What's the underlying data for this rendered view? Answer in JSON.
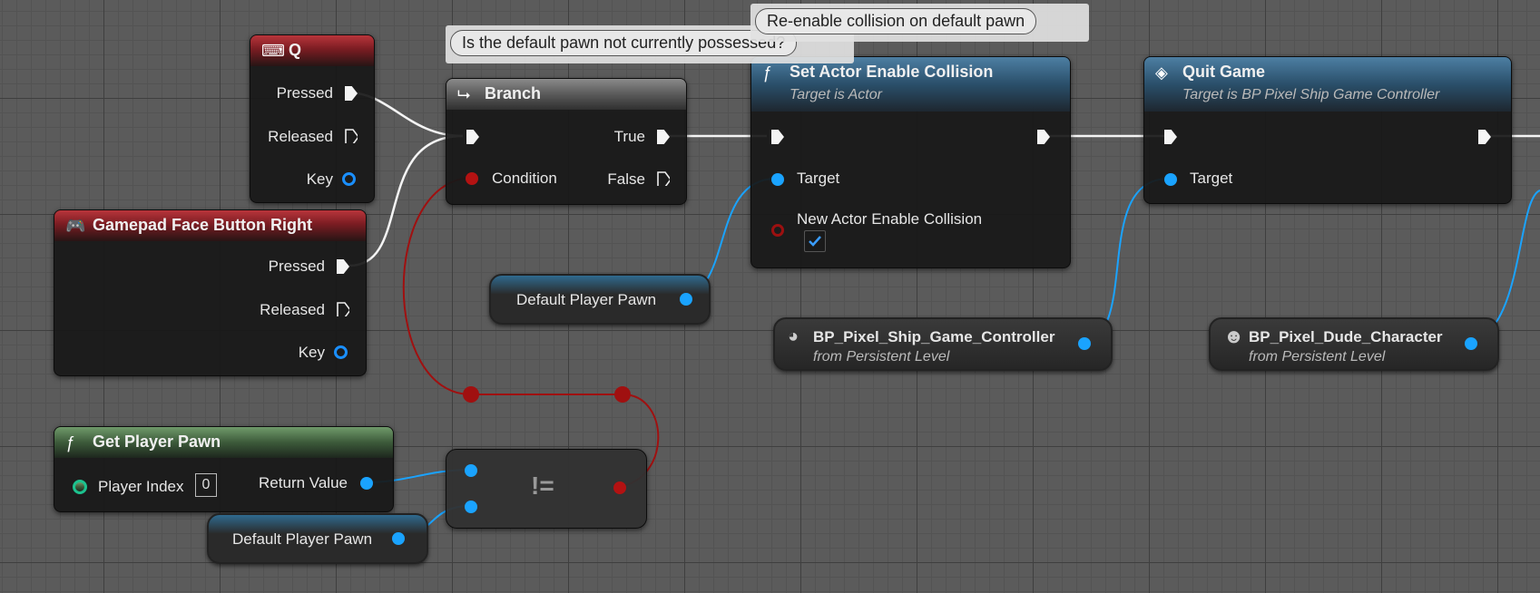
{
  "comments": {
    "branch_comment": "Is the default pawn not currently possessed?",
    "collision_comment": "Re-enable collision on default pawn"
  },
  "nodes": {
    "q_event": {
      "title": "Q",
      "pins": {
        "pressed": "Pressed",
        "released": "Released",
        "key": "Key"
      }
    },
    "gamepad_event": {
      "title": "Gamepad Face Button Right",
      "pins": {
        "pressed": "Pressed",
        "released": "Released",
        "key": "Key"
      }
    },
    "branch": {
      "title": "Branch",
      "pins": {
        "condition": "Condition",
        "true": "True",
        "false": "False"
      }
    },
    "set_collision": {
      "title": "Set Actor Enable Collision",
      "subtitle": "Target is Actor",
      "pins": {
        "target": "Target",
        "new_enable": "New Actor Enable Collision"
      },
      "checkbox_checked": true
    },
    "quit_game": {
      "title": "Quit Game",
      "subtitle": "Target is BP Pixel Ship Game Controller",
      "pins": {
        "target": "Target"
      }
    },
    "get_player_pawn": {
      "title": "Get Player Pawn",
      "pins": {
        "player_index": "Player Index",
        "player_index_value": "0",
        "return_value": "Return Value"
      }
    },
    "not_equal": {
      "symbol": "!="
    },
    "default_pawn_1": {
      "label": "Default Player Pawn"
    },
    "default_pawn_2": {
      "label": "Default Player Pawn"
    },
    "ship_controller_ref": {
      "label": "BP_Pixel_Ship_Game_Controller",
      "sub": "from Persistent Level"
    },
    "dude_character_ref": {
      "label": "BP_Pixel_Dude_Character",
      "sub": "from Persistent Level"
    }
  },
  "colors": {
    "exec": "#f4f4f4",
    "object_pin": "#1aa3ff",
    "bool_pin": "#b31212",
    "event_header": "#b8353b",
    "function_header": "#4d7fa3",
    "pure_header": "#6f9a6a"
  },
  "icons": {
    "q_event": "keyboard-icon",
    "gamepad_event": "gamepad-icon",
    "branch": "branch-icon",
    "set_collision": "function-icon",
    "quit_game": "quit-game-icon",
    "get_player_pawn": "function-icon",
    "ship_controller_ref": "actor-icon",
    "dude_character_ref": "character-icon"
  }
}
